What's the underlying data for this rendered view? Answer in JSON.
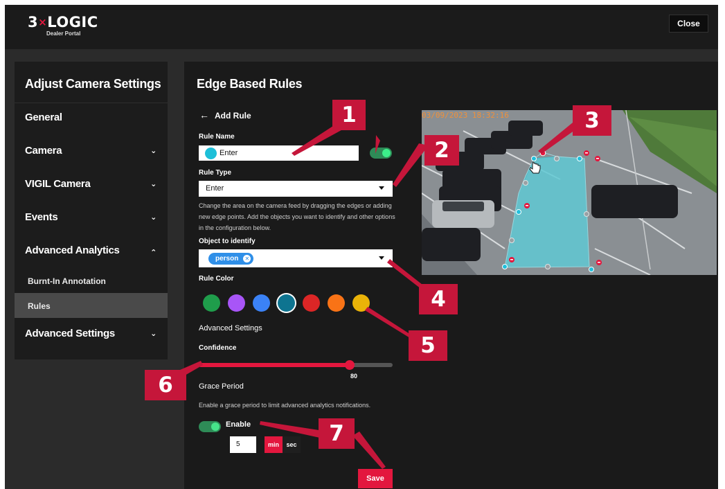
{
  "header": {
    "logo_text": "3",
    "logo_x": "×",
    "logo_text_2": "LOGIC",
    "logo_subtitle": "Dealer Portal",
    "close_label": "Close"
  },
  "sidebar": {
    "title": "Adjust Camera Settings",
    "items": [
      {
        "label": "General",
        "chevron": ""
      },
      {
        "label": "Camera",
        "chevron": "⌄"
      },
      {
        "label": "VIGIL Camera",
        "chevron": "⌄"
      },
      {
        "label": "Events",
        "chevron": "⌄"
      },
      {
        "label": "Advanced Analytics",
        "chevron": "⌃"
      },
      {
        "label": "Advanced Settings",
        "chevron": "⌄"
      }
    ],
    "subitems": [
      {
        "label": "Burnt-In Annotation",
        "active": false
      },
      {
        "label": "Rules",
        "active": true
      }
    ]
  },
  "main": {
    "title": "Edge Based Rules",
    "back_label": "Add Rule",
    "rule_name_label": "Rule Name",
    "rule_name_value": "Enter",
    "rule_enabled": true,
    "rule_type_label": "Rule Type",
    "rule_type_value": "Enter",
    "help_text": "Change the area on the camera feed by dragging the edges or adding new edge points. Add the objects you want to identify and other options in the configuration below.",
    "object_label": "Object to identify",
    "object_chip": "person",
    "rule_color_label": "Rule Color",
    "rule_colors": [
      "#1f9d4b",
      "#a855f7",
      "#3b82f6",
      "#0e7490",
      "#dc2626",
      "#f97316",
      "#eab308"
    ],
    "selected_color_index": 3,
    "advanced_settings_label": "Advanced Settings",
    "confidence_label": "Confidence",
    "confidence_value": "80",
    "confidence_fraction": 0.78,
    "grace_period_label": "Grace Period",
    "grace_help": "Enable a grace period to limit advanced analytics notifications.",
    "grace_enable_label": "Enable",
    "grace_enabled": true,
    "grace_value": "5",
    "unit_min": "min",
    "unit_sec": "sec",
    "selected_unit": "min",
    "save_label": "Save"
  },
  "camera": {
    "timestamp": "03/09/2023 18:32:16"
  },
  "callouts": [
    "1",
    "2",
    "3",
    "4",
    "5",
    "6",
    "7"
  ],
  "colors": {
    "accent": "#e3173e",
    "callout": "#c5163a",
    "zone": "#5fc9d4",
    "toggle_on": "#2e8b57"
  }
}
